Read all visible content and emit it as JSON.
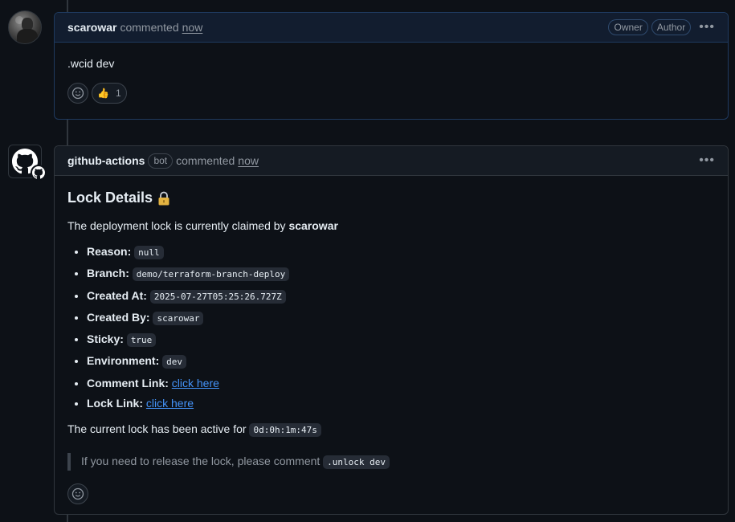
{
  "comment1": {
    "author": "scarowar",
    "verb": "commented",
    "time": "now",
    "badges": [
      "Owner",
      "Author"
    ],
    "body": ".wcid dev",
    "reaction": {
      "emoji": "👍",
      "count": "1"
    }
  },
  "comment2": {
    "author": "github-actions",
    "bot_badge": "bot",
    "verb": "commented",
    "time": "now",
    "title": "Lock Details",
    "intro_prefix": "The deployment lock is currently claimed by",
    "intro_user": "scarowar",
    "details": [
      {
        "label": "Reason:",
        "value": "null",
        "type": "code"
      },
      {
        "label": "Branch:",
        "value": "demo/terraform-branch-deploy",
        "type": "code"
      },
      {
        "label": "Created At:",
        "value": "2025-07-27T05:25:26.727Z",
        "type": "code"
      },
      {
        "label": "Created By:",
        "value": "scarowar",
        "type": "code"
      },
      {
        "label": "Sticky:",
        "value": "true",
        "type": "code"
      },
      {
        "label": "Environment:",
        "value": "dev",
        "type": "code"
      },
      {
        "label": "Comment Link:",
        "value": "click here",
        "type": "link"
      },
      {
        "label": "Lock Link:",
        "value": "click here",
        "type": "link"
      }
    ],
    "active_prefix": "The current lock has been active for",
    "active_value": "0d:0h:1m:47s",
    "quote_prefix": "If you need to release the lock, please comment",
    "quote_code": ".unlock dev"
  },
  "colors": {
    "background": "#0d1117",
    "link": "#4493f8",
    "muted": "#9198a1",
    "owner_border": "#1f3a5f",
    "lock_gold": "#e3b341"
  },
  "icons": {
    "avatar_user": "user-avatar",
    "avatar_bot": "github-octocat-icon",
    "smiley": "smiley-icon",
    "kebab": "kebab-horizontal-icon",
    "lock": "lock-icon"
  }
}
